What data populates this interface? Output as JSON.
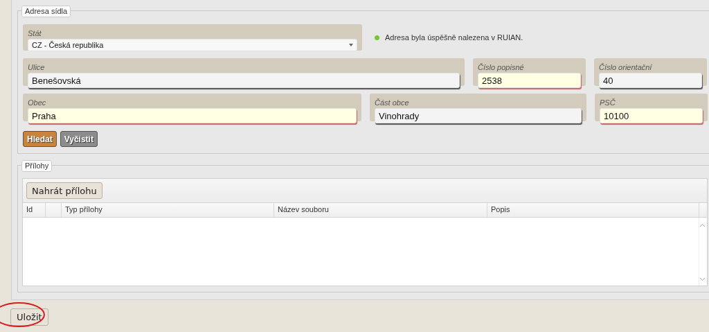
{
  "address": {
    "legend": "Adresa sídla",
    "country": {
      "label": "Stát",
      "value": "CZ - Česká republika",
      "kind": "select",
      "required": false
    },
    "status": {
      "color": "#77c63a",
      "text": "Adresa byla úspěšně nalezena v RUIAN."
    },
    "rows": [
      {
        "fields": [
          {
            "label": "Ulice",
            "value": "Benešovská",
            "kind": "text",
            "required": false
          },
          {
            "label": "Číslo popisné",
            "value": "2538",
            "kind": "text",
            "required": true
          },
          {
            "label": "Číslo orientační",
            "value": "40",
            "kind": "text",
            "required": false
          }
        ]
      },
      {
        "fields": [
          {
            "label": "Obec",
            "value": "Praha",
            "kind": "text",
            "required": true
          },
          {
            "label": "Část obce",
            "value": "Vinohrady",
            "kind": "text",
            "required": false
          },
          {
            "label": "PSČ",
            "value": "10100",
            "kind": "text",
            "required": true
          }
        ]
      }
    ],
    "buttons": [
      {
        "label": "Hledat",
        "kind": "primary"
      },
      {
        "label": "Vyčistit",
        "kind": "secondary"
      }
    ]
  },
  "attachments": {
    "legend": "Přílohy",
    "upload_button": "Nahrát přílohu",
    "columns": [
      "Id",
      "Typ přílohy",
      "Název souboru",
      "Popis"
    ]
  },
  "save_button": {
    "label": "Uložit",
    "circled": true
  }
}
